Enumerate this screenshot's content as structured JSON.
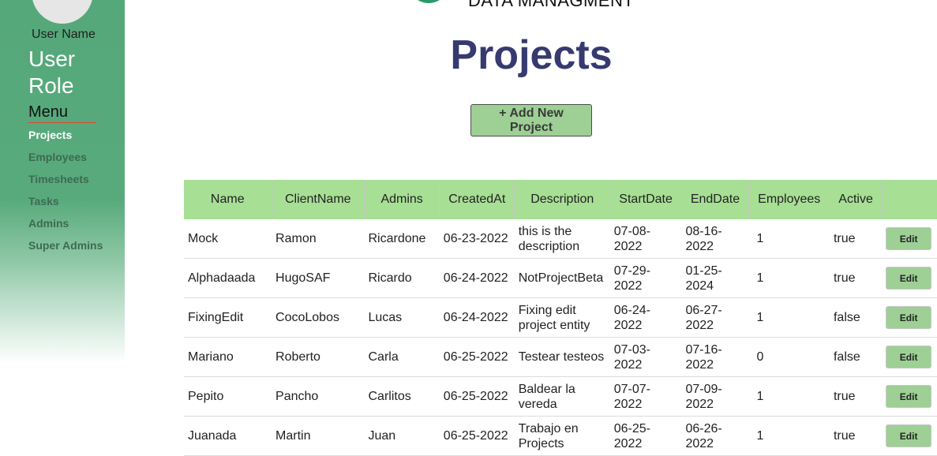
{
  "sidebar": {
    "user_name": "User Name",
    "user_role": "User Role",
    "menu_title": "Menu",
    "items": [
      {
        "label": "Projects",
        "active": true
      },
      {
        "label": "Employees",
        "active": false
      },
      {
        "label": "Timesheets",
        "active": false
      },
      {
        "label": "Tasks",
        "active": false
      },
      {
        "label": "Admins",
        "active": false
      },
      {
        "label": "Super Admins",
        "active": false
      }
    ]
  },
  "header": {
    "brand": "DATA MANAGMENT",
    "title": "Projects"
  },
  "actions": {
    "add_label": "+ Add New Project"
  },
  "table": {
    "columns": [
      "Name",
      "ClientName",
      "Admins",
      "CreatedAt",
      "Description",
      "StartDate",
      "EndDate",
      "Employees",
      "Active",
      ""
    ],
    "edit_label": "Edit",
    "rows": [
      {
        "name": "Mock",
        "client": "Ramon",
        "admins": "Ricardone",
        "created": "06-23-2022",
        "description": "this is the description",
        "start": "07-08-2022",
        "end": "08-16-2022",
        "employees": "1",
        "active": "true"
      },
      {
        "name": "Alphadaada",
        "client": "HugoSAF",
        "admins": "Ricardo",
        "created": "06-24-2022",
        "description": "NotProjectBeta",
        "start": "07-29-2022",
        "end": "01-25-2024",
        "employees": "1",
        "active": "true"
      },
      {
        "name": "FixingEdit",
        "client": "CocoLobos",
        "admins": "Lucas",
        "created": "06-24-2022",
        "description": "Fixing edit project entity",
        "start": "06-24-2022",
        "end": "06-27-2022",
        "employees": "1",
        "active": "false"
      },
      {
        "name": "Mariano",
        "client": "Roberto",
        "admins": "Carla",
        "created": "06-25-2022",
        "description": "Testear testeos",
        "start": "07-03-2022",
        "end": "07-16-2022",
        "employees": "0",
        "active": "false"
      },
      {
        "name": "Pepito",
        "client": "Pancho",
        "admins": "Carlitos",
        "created": "06-25-2022",
        "description": "Baldear la vereda",
        "start": "07-07-2022",
        "end": "07-09-2022",
        "employees": "1",
        "active": "true"
      },
      {
        "name": "Juanada",
        "client": "Martin",
        "admins": "Juan",
        "created": "06-25-2022",
        "description": "Trabajo en Projects",
        "start": "06-25-2022",
        "end": "06-26-2022",
        "employees": "1",
        "active": "true"
      }
    ]
  },
  "colors": {
    "sidebar": "#55a87a",
    "header_row": "#a7df95",
    "button": "#9ed095",
    "title": "#363a6e"
  }
}
